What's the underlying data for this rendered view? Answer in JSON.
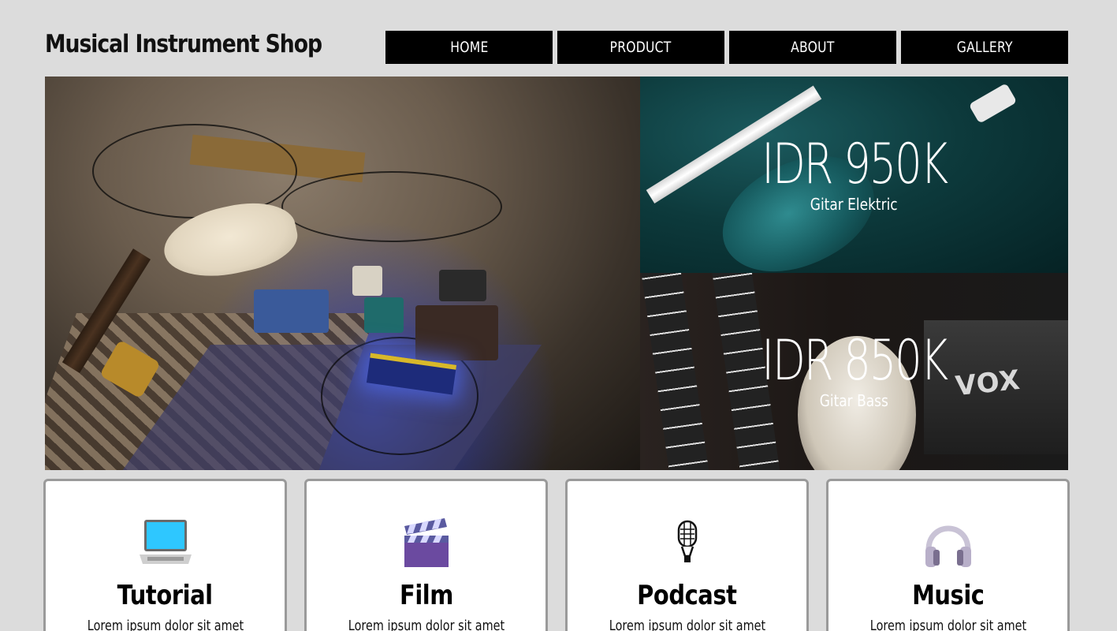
{
  "header": {
    "site_title": "Musical Instrument Shop",
    "nav": [
      "HOME",
      "PRODUCT",
      "ABOUT",
      "GALLERY"
    ]
  },
  "hero": {
    "main_image": "guitar-pedals-photo",
    "cards": [
      {
        "price": "IDR 950K",
        "label": "Gitar Elektric",
        "image": "electric-guitar-photo"
      },
      {
        "price": "IDR 850K",
        "label": "Gitar Bass",
        "image": "bass-guitar-photo",
        "amp_brand": "VOX"
      }
    ]
  },
  "features": [
    {
      "icon": "laptop-icon",
      "title": "Tutorial",
      "text": "Lorem ipsum dolor sit amet"
    },
    {
      "icon": "clapperboard-icon",
      "title": "Film",
      "text": "Lorem ipsum dolor sit amet"
    },
    {
      "icon": "microphone-icon",
      "title": "Podcast",
      "text": "Lorem ipsum dolor sit amet"
    },
    {
      "icon": "headphones-icon",
      "title": "Music",
      "text": "Lorem ipsum dolor sit amet"
    }
  ],
  "colors": {
    "background": "#dcdcdc",
    "nav_bg": "#000000",
    "nav_text": "#ffffff",
    "card_border": "#9a9a9a"
  }
}
